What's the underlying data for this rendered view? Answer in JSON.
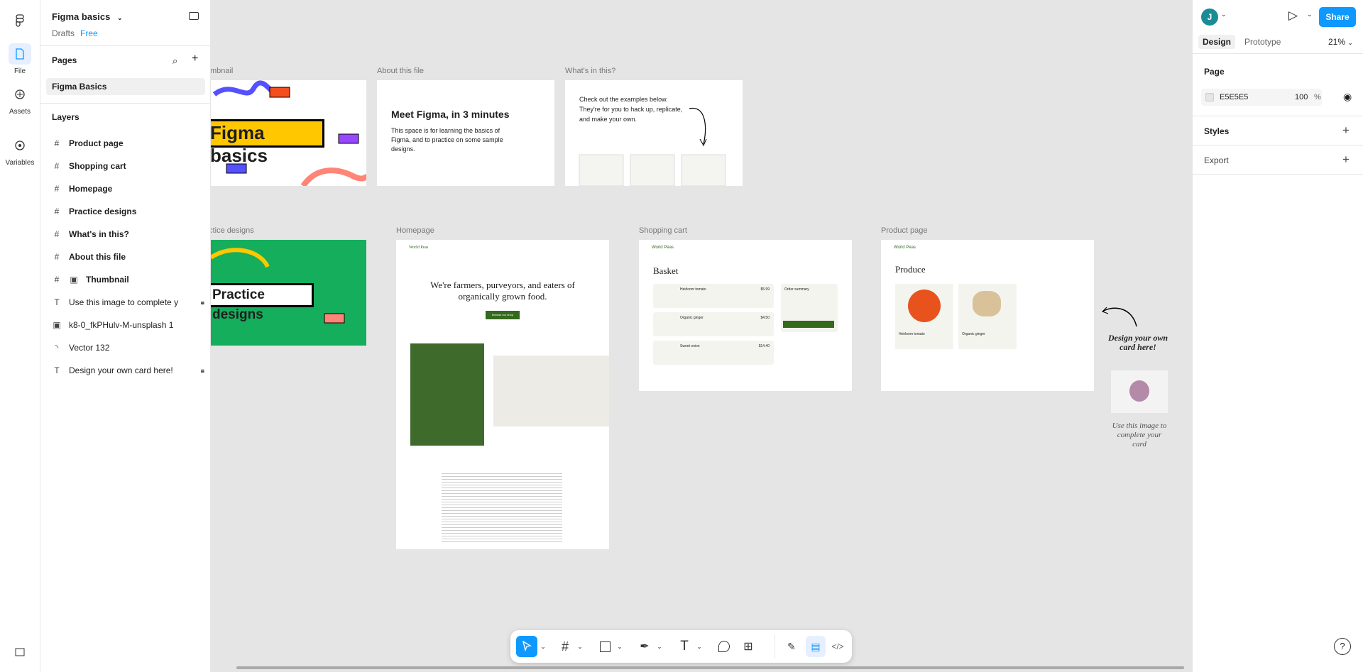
{
  "app": {
    "project_title": "Figma basics",
    "drafts": "Drafts",
    "plan": "Free"
  },
  "rail": {
    "file": "File",
    "assets": "Assets",
    "variables": "Variables"
  },
  "pages": {
    "header": "Pages",
    "items": [
      "Figma Basics"
    ]
  },
  "layers": {
    "header": "Layers",
    "items": [
      {
        "label": "Product page",
        "kind": "frame"
      },
      {
        "label": "Shopping cart",
        "kind": "frame"
      },
      {
        "label": "Homepage",
        "kind": "frame"
      },
      {
        "label": "Practice designs",
        "kind": "frame"
      },
      {
        "label": "What's in this?",
        "kind": "frame"
      },
      {
        "label": "About this file",
        "kind": "frame"
      },
      {
        "label": "Thumbnail",
        "kind": "frame-image"
      },
      {
        "label": "Use this image to complete y",
        "kind": "text",
        "locked": true
      },
      {
        "label": "k8-0_fkPHulv-M-unsplash 1",
        "kind": "image"
      },
      {
        "label": "Vector 132",
        "kind": "vector"
      },
      {
        "label": "Design your own card here!",
        "kind": "text",
        "locked": true
      }
    ]
  },
  "right": {
    "avatar": "J",
    "share": "Share",
    "tab_design": "Design",
    "tab_prototype": "Prototype",
    "zoom": "21%",
    "page_section": "Page",
    "page_color": "E5E5E5",
    "page_opacity": "100",
    "percent": "%",
    "styles": "Styles",
    "export": "Export"
  },
  "canvas": {
    "labels": {
      "thumbnail": "Thumbnail",
      "about": "About this file",
      "whats": "What's in this?",
      "practice": "Practice designs",
      "homepage": "Homepage",
      "cart": "Shopping cart",
      "product": "Product page"
    },
    "thumb_text": "Figma basics",
    "about_title": "Meet Figma, in 3 minutes",
    "about_body": "This space is for learning the basics of Figma, and to practice on some sample designs.",
    "whats_body": "Check out the examples below. They're for you to hack up, replicate, and make your own.",
    "practice_text": "Practice designs",
    "brand": "World Peas",
    "home_headline": "We're farmers, purveyors, and eaters of organically grown food.",
    "home_button": "Browse our shop",
    "cart_title": "Basket",
    "cart_items": [
      "Heirloom tomato",
      "Organic ginger",
      "Sweet onion"
    ],
    "cart_prices": [
      "$5.99",
      "$4.50",
      "$14.40"
    ],
    "order_summary": "Order summary",
    "product_title": "Produce",
    "product_items": [
      "Heirloom tomato",
      "Organic ginger"
    ],
    "card_note": "Design your own card here!",
    "image_note": "Use this image to complete your card"
  }
}
